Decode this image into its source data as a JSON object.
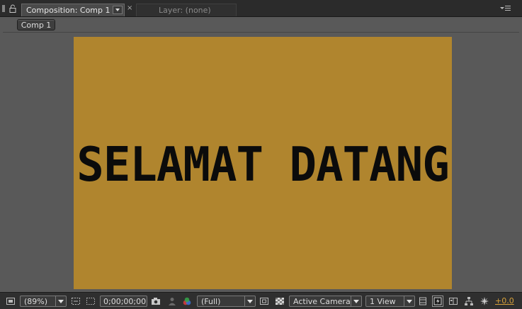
{
  "colors": {
    "panel_bg": "#595959",
    "canvas_bg": "#b0852e",
    "canvas_text": "#0b0b0b",
    "exposure_accent": "#d6a03a"
  },
  "tabs": {
    "active_label": "Composition: Comp 1",
    "inactive_label": "Layer: (none)",
    "close_glyph": "×"
  },
  "comp_button": {
    "label": "Comp 1"
  },
  "canvas": {
    "text": "SELAMAT DATANG"
  },
  "toolbar": {
    "magnification": "(89%)",
    "timecode": "0;00;00;00",
    "resolution": "(Full)",
    "camera": "Active Camera",
    "views": "1 View",
    "exposure": "+0.0"
  },
  "icons": [
    "panel-grip-icon",
    "lock-icon",
    "panel-menu-icon",
    "always-preview-icon",
    "region-of-interest-icon",
    "toggle-mask-icon",
    "snapshot-icon",
    "show-snapshot-icon",
    "channel-icon",
    "fast-preview-icon",
    "transparency-grid-icon",
    "toggle-pixel-aspect-icon",
    "3d-draft-icon",
    "comp-flowchart-icon",
    "timeline-icon",
    "reset-exposure-icon"
  ]
}
